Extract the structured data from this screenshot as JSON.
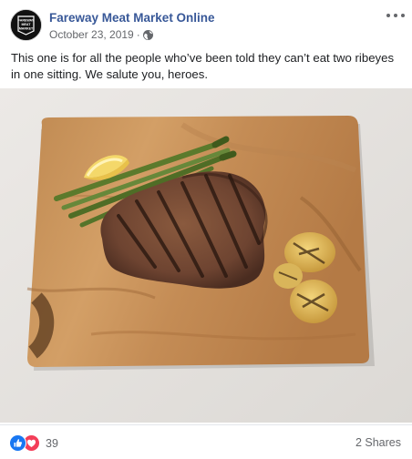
{
  "post": {
    "page_name": "Fareway Meat Market Online",
    "date": "October 23, 2019",
    "separator": "·",
    "caption": "This one is for all the people who’ve been told they can’t eat two ribeyes in one sitting. We salute you, heroes.",
    "avatar_text": [
      "FAREWAY",
      "MEAT",
      "MARKET"
    ],
    "icons": [
      "globe-icon",
      "more-options-icon",
      "like-reaction-icon",
      "love-reaction-icon"
    ]
  },
  "footer": {
    "reaction_count": "39",
    "shares_label": "2 Shares"
  },
  "colors": {
    "page_name": "#385898",
    "like": "#1877f2",
    "love": "#f33e58",
    "meta_text": "#65676b"
  }
}
